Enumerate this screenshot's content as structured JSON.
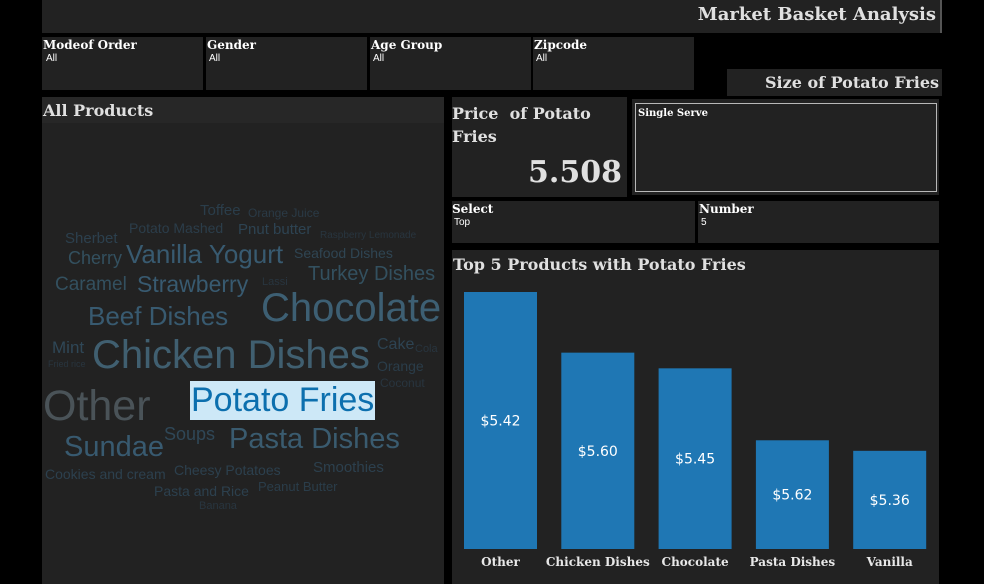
{
  "title": "Market Basket Analysis",
  "filters": [
    {
      "label": "Modeof Order",
      "value": "All"
    },
    {
      "label": "Gender",
      "value": "All"
    },
    {
      "label": "Age Group",
      "value": "All"
    },
    {
      "label": "Zipcode",
      "value": "All"
    }
  ],
  "size_section": {
    "title": "Size of Potato Fries",
    "selected": "Single Serve"
  },
  "all_products": {
    "title": "All Products",
    "words": [
      {
        "text": "Toffee",
        "color": "#2a3d4a"
      },
      {
        "text": "Orange Juice",
        "color": "#2a3a46"
      },
      {
        "text": "Potato Mashed",
        "color": "#2b3d4a"
      },
      {
        "text": "Pnut butter",
        "color": "#2d4352"
      },
      {
        "text": "Raspberry Lemonade",
        "color": "#28353f"
      },
      {
        "text": "Sherbet",
        "color": "#2c404e"
      },
      {
        "text": "Cherry",
        "color": "#33505f"
      },
      {
        "text": "Vanilla Yogurt",
        "color": "#385a70"
      },
      {
        "text": "Seafood Dishes",
        "color": "#2f4553"
      },
      {
        "text": "Caramel",
        "color": "#33505f"
      },
      {
        "text": "Strawberry",
        "color": "#385a70"
      },
      {
        "text": "Lassi",
        "color": "#28353f"
      },
      {
        "text": "Turkey Dishes",
        "color": "#33505f"
      },
      {
        "text": "Beef Dishes",
        "color": "#385a70"
      },
      {
        "text": "Chocolate",
        "color": "#3d5f73"
      },
      {
        "text": "Mint",
        "color": "#2f4757"
      },
      {
        "text": "Chicken Dishes",
        "color": "#405f70"
      },
      {
        "text": "Cake",
        "color": "#2d4352"
      },
      {
        "text": "Cola",
        "color": "#28353f"
      },
      {
        "text": "Fried rice",
        "color": "#28353f"
      },
      {
        "text": "Orange",
        "color": "#2a3d4a"
      },
      {
        "text": "Other",
        "color": "#4a5358"
      },
      {
        "text": "Potato Fries",
        "color": "#0c6fae"
      },
      {
        "text": "Coconut",
        "color": "#28353f"
      },
      {
        "text": "Sundae",
        "color": "#385a70"
      },
      {
        "text": "Soups",
        "color": "#2f4757"
      },
      {
        "text": "Pasta Dishes",
        "color": "#3a5b6f"
      },
      {
        "text": "Cookies and cream",
        "color": "#2c404e"
      },
      {
        "text": "Cheesy Potatoes",
        "color": "#2c404e"
      },
      {
        "text": "Smoothies",
        "color": "#2c404e"
      },
      {
        "text": "Pasta and Rice",
        "color": "#2c404e"
      },
      {
        "text": "Peanut Butter",
        "color": "#2a3d4a"
      },
      {
        "text": "Banana",
        "color": "#28353f"
      }
    ]
  },
  "price": {
    "title": "Price  of Potato Fries",
    "value": "5.508"
  },
  "select": {
    "label": "Select",
    "value": "Top"
  },
  "number": {
    "label": "Number",
    "value": "5"
  },
  "chart_title": "Top 5 Products with Potato Fries",
  "colors": {
    "bar": "#1f77b4",
    "panel": "#222222",
    "size_box": "#27477a",
    "highlight": "#cde8f7"
  },
  "chart_data": {
    "type": "bar",
    "title": "Top 5 Products with Potato Fries",
    "categories": [
      "Other",
      "Chicken Dishes",
      "Chocolate",
      "Pasta Dishes",
      "Vanilla"
    ],
    "relative_heights": [
      1.0,
      0.764,
      0.703,
      0.423,
      0.382
    ],
    "data_labels": [
      "$5.42",
      "$5.60",
      "$5.45",
      "$5.62",
      "$5.36"
    ],
    "xlabel": "",
    "ylabel": "",
    "grid": false,
    "legend": "none"
  }
}
